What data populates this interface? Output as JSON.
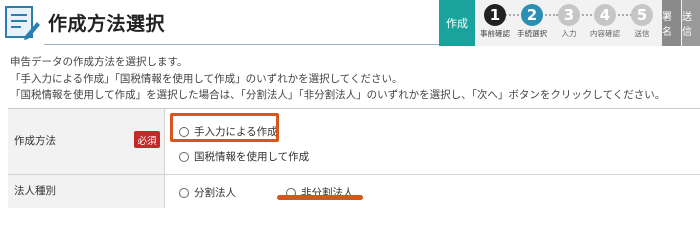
{
  "header": {
    "title": "作成方法選択"
  },
  "steps": {
    "current_label": "作成",
    "items": [
      {
        "num": "1",
        "label": "事前確認",
        "state": "done"
      },
      {
        "num": "2",
        "label": "手続選択",
        "state": "active"
      },
      {
        "num": "3",
        "label": "入力",
        "state": "todo"
      },
      {
        "num": "4",
        "label": "内容確認",
        "state": "todo"
      },
      {
        "num": "5",
        "label": "送信",
        "state": "todo"
      }
    ],
    "side_tabs": [
      "署名",
      "送信"
    ]
  },
  "description": {
    "line1": "申告データの作成方法を選択します。",
    "line2": "「手入力による作成」「国税情報を使用して作成」のいずれかを選択してください。",
    "line3": "「国税情報を使用して作成」を選択した場合は、「分割法人」「非分割法人」のいずれかを選択し、「次へ」ボタンをクリックしてください。"
  },
  "form": {
    "method": {
      "label": "作成方法",
      "required_badge": "必須",
      "options": [
        "手入力による作成",
        "国税情報を使用して作成"
      ]
    },
    "corp_type": {
      "label": "法人種別",
      "options": [
        "分割法人",
        "非分割法人"
      ]
    }
  },
  "colors": {
    "accent_teal": "#1aa39d",
    "step_active": "#2a8fb3",
    "required_red": "#c22a2a",
    "annotation_orange": "#d6561c"
  }
}
